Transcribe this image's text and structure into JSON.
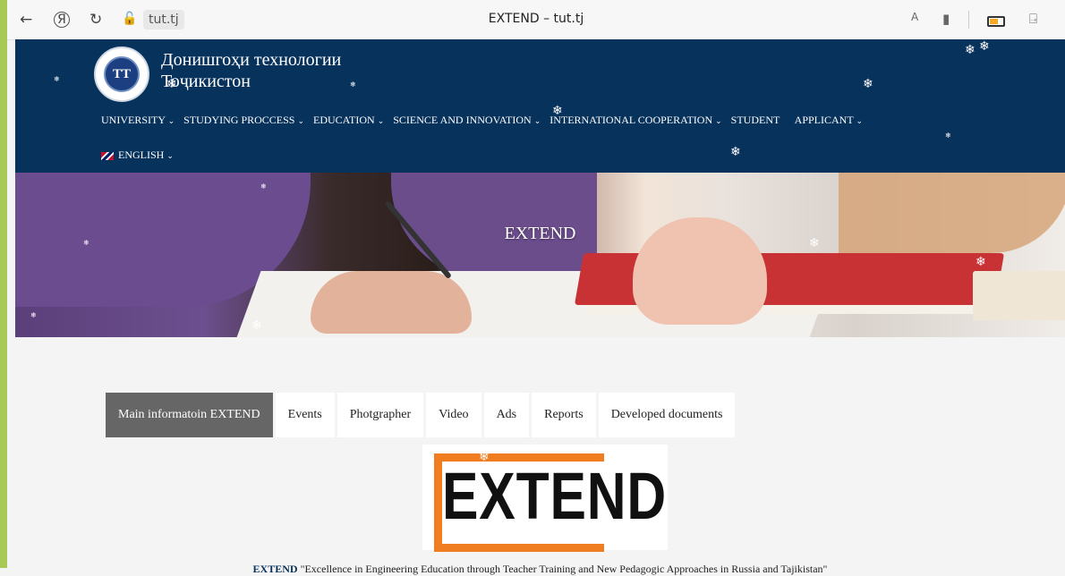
{
  "browser": {
    "back_icon": "←",
    "yandex_icon": "Я",
    "reload_icon": "↻",
    "lock_icon": "🔓",
    "url": "tut.tj",
    "tab_title": "EXTEND – tut.tj",
    "translate_icon": "A",
    "bookmark_icon": "▮",
    "reader_icon": "⍈"
  },
  "header": {
    "logo_text": "ТТ",
    "university_name_line1": "Донишгоҳи технологии",
    "university_name_line2": "Тоҷикистон",
    "background": "#07325c"
  },
  "nav": {
    "items": [
      {
        "label": "UNIVERSITY",
        "dropdown": true
      },
      {
        "label": "STUDYING PROCCESS",
        "dropdown": true
      },
      {
        "label": "EDUCATION",
        "dropdown": true
      },
      {
        "label": "SCIENCE AND INNOVATION",
        "dropdown": true
      },
      {
        "label": "INTERNATIONAL COOPERATION",
        "dropdown": true
      },
      {
        "label": "STUDENT",
        "dropdown": false
      },
      {
        "label": "APPLICANT",
        "dropdown": true
      }
    ],
    "language": "ENGLISH",
    "chevron": "⌄"
  },
  "banner": {
    "title": "EXTEND"
  },
  "tabs": [
    {
      "label": "Main informatoin EXTEND",
      "active": true
    },
    {
      "label": "Events",
      "active": false
    },
    {
      "label": "Photgrapher",
      "active": false
    },
    {
      "label": "Video",
      "active": false
    },
    {
      "label": "Ads",
      "active": false
    },
    {
      "label": "Reports",
      "active": false
    },
    {
      "label": "Developed documents",
      "active": false
    }
  ],
  "content": {
    "logo_text": "EXTEND",
    "caption_bold": "EXTEND",
    "caption_rest": " \"Excellence in Engineering Education through Teacher Training and New Pedagogic Approaches in Russia and Tajikistan\"",
    "accent_color": "#f07d1f"
  },
  "snowflake": "❄"
}
